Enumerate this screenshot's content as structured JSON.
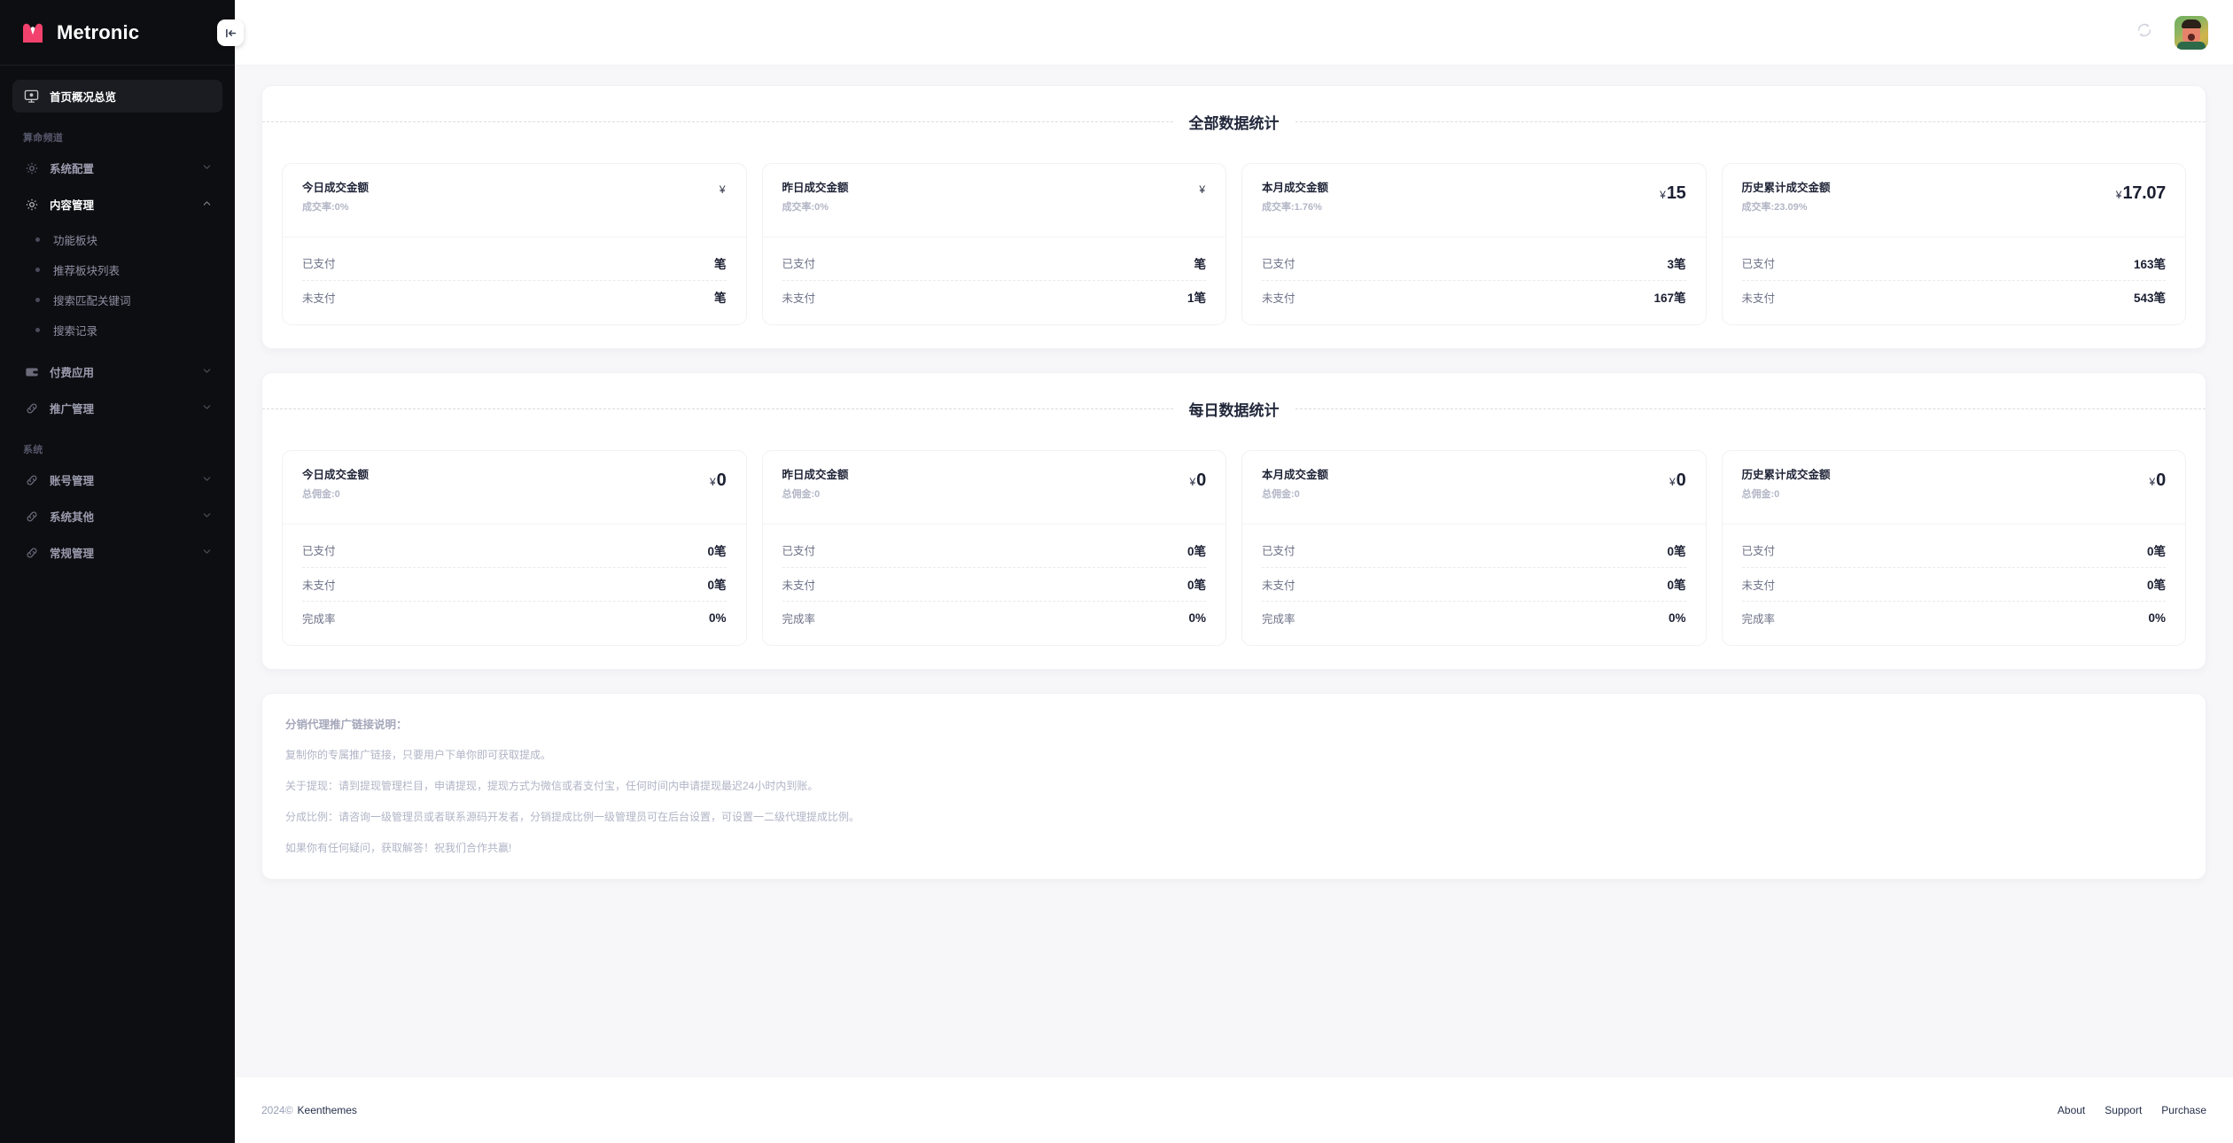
{
  "app": {
    "brand": "Metronic",
    "logo_color": "#f1416c"
  },
  "sidebar": {
    "collapse_icon": "collapse-left-icon",
    "home": {
      "label": "首页概况总览",
      "icon": "monitor-icon"
    },
    "groups": [
      {
        "title": "算命频道",
        "items": [
          {
            "label": "系统配置",
            "icon": "gear-icon",
            "expanded": false,
            "children": []
          },
          {
            "label": "内容管理",
            "icon": "gear-icon",
            "expanded": true,
            "children": [
              "功能板块",
              "推荐板块列表",
              "搜索匹配关键词",
              "搜索记录"
            ]
          },
          {
            "label": "付费应用",
            "icon": "wallet-icon",
            "expanded": false,
            "children": []
          },
          {
            "label": "推广管理",
            "icon": "link-icon",
            "expanded": false,
            "children": []
          }
        ]
      },
      {
        "title": "系统",
        "items": [
          {
            "label": "账号管理",
            "icon": "link-icon",
            "expanded": false,
            "children": []
          },
          {
            "label": "系统其他",
            "icon": "link-icon",
            "expanded": false,
            "children": []
          },
          {
            "label": "常规管理",
            "icon": "link-icon",
            "expanded": false,
            "children": []
          }
        ]
      }
    ]
  },
  "topbar": {
    "refresh_icon": "refresh-spinner-icon",
    "avatar": "user-avatar"
  },
  "sections": [
    {
      "title": "全部数据统计",
      "cards": [
        {
          "title": "今日成交金额",
          "subtitle": "成交率:0%",
          "currency": "¥",
          "amount": "",
          "rows": [
            {
              "label": "已支付",
              "value": "笔"
            },
            {
              "label": "未支付",
              "value": "笔"
            }
          ]
        },
        {
          "title": "昨日成交金额",
          "subtitle": "成交率:0%",
          "currency": "¥",
          "amount": "",
          "rows": [
            {
              "label": "已支付",
              "value": "笔"
            },
            {
              "label": "未支付",
              "value": "1笔"
            }
          ]
        },
        {
          "title": "本月成交金额",
          "subtitle": "成交率:1.76%",
          "currency": "¥",
          "amount": "15",
          "rows": [
            {
              "label": "已支付",
              "value": "3笔"
            },
            {
              "label": "未支付",
              "value": "167笔"
            }
          ]
        },
        {
          "title": "历史累计成交金额",
          "subtitle": "成交率:23.09%",
          "currency": "¥",
          "amount": "17.07",
          "rows": [
            {
              "label": "已支付",
              "value": "163笔"
            },
            {
              "label": "未支付",
              "value": "543笔"
            }
          ]
        }
      ]
    },
    {
      "title": "每日数据统计",
      "cards": [
        {
          "title": "今日成交金额",
          "subtitle": "总佣金:0",
          "currency": "¥",
          "amount": "0",
          "rows": [
            {
              "label": "已支付",
              "value": "0笔"
            },
            {
              "label": "未支付",
              "value": "0笔"
            },
            {
              "label": "完成率",
              "value": "0%"
            }
          ]
        },
        {
          "title": "昨日成交金额",
          "subtitle": "总佣金:0",
          "currency": "¥",
          "amount": "0",
          "rows": [
            {
              "label": "已支付",
              "value": "0笔"
            },
            {
              "label": "未支付",
              "value": "0笔"
            },
            {
              "label": "完成率",
              "value": "0%"
            }
          ]
        },
        {
          "title": "本月成交金额",
          "subtitle": "总佣金:0",
          "currency": "¥",
          "amount": "0",
          "rows": [
            {
              "label": "已支付",
              "value": "0笔"
            },
            {
              "label": "未支付",
              "value": "0笔"
            },
            {
              "label": "完成率",
              "value": "0%"
            }
          ]
        },
        {
          "title": "历史累计成交金额",
          "subtitle": "总佣金:0",
          "currency": "¥",
          "amount": "0",
          "rows": [
            {
              "label": "已支付",
              "value": "0笔"
            },
            {
              "label": "未支付",
              "value": "0笔"
            },
            {
              "label": "完成率",
              "value": "0%"
            }
          ]
        }
      ]
    }
  ],
  "notes": {
    "title": "分销代理推广链接说明：",
    "lines": [
      "复制你的专属推广链接，只要用户下单你即可获取提成。",
      "关于提现：请到提现管理栏目，申请提现，提现方式为微信或者支付宝，任何时间内申请提现最迟24小时内到账。",
      "分成比例：请咨询一级管理员或者联系源码开发者，分销提成比例一级管理员可在后台设置，可设置一二级代理提成比例。",
      "如果你有任何疑问，获取解答！祝我们合作共赢!"
    ]
  },
  "footer": {
    "year": "2024©",
    "company": "Keenthemes",
    "links": [
      "About",
      "Support",
      "Purchase"
    ]
  }
}
